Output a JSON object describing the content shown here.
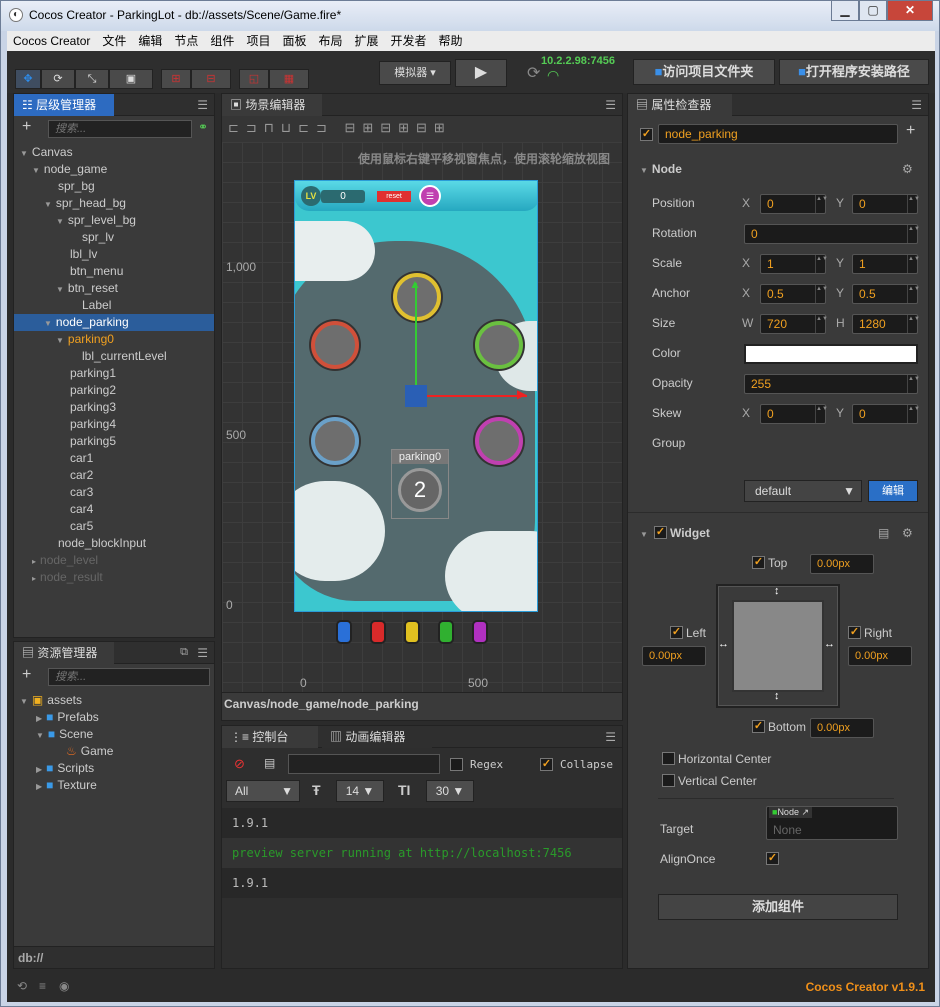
{
  "window": {
    "title": "Cocos Creator - ParkingLot - db://assets/Scene/Game.fire*",
    "min": "▁",
    "max": "▢",
    "close": "✕"
  },
  "menu": [
    "Cocos Creator",
    "文件",
    "编辑",
    "节点",
    "组件",
    "项目",
    "面板",
    "布局",
    "扩展",
    "开发者",
    "帮助"
  ],
  "toolbar": {
    "platform": "模拟器",
    "ip": "10.2.2.98:7456",
    "open_project": "访问项目文件夹",
    "open_install": "打开程序安装路径"
  },
  "hierarchy": {
    "title": "层级管理器",
    "search_placeholder": "搜索...",
    "items": [
      {
        "label": "Canvas",
        "depth": 0,
        "arrow": "▼"
      },
      {
        "label": "node_game",
        "depth": 1,
        "arrow": "▼"
      },
      {
        "label": "spr_bg",
        "depth": 2,
        "arrow": ""
      },
      {
        "label": "spr_head_bg",
        "depth": 2,
        "arrow": "▼"
      },
      {
        "label": "spr_level_bg",
        "depth": 3,
        "arrow": "▼"
      },
      {
        "label": "spr_lv",
        "depth": 4,
        "arrow": ""
      },
      {
        "label": "lbl_lv",
        "depth": 3,
        "arrow": ""
      },
      {
        "label": "btn_menu",
        "depth": 3,
        "arrow": ""
      },
      {
        "label": "btn_reset",
        "depth": 3,
        "arrow": "▼"
      },
      {
        "label": "Label",
        "depth": 4,
        "arrow": ""
      },
      {
        "label": "node_parking",
        "depth": 2,
        "arrow": "▼",
        "selected": true
      },
      {
        "label": "parking0",
        "depth": 3,
        "arrow": "▼",
        "highlight": true
      },
      {
        "label": "lbl_currentLevel",
        "depth": 4,
        "arrow": ""
      },
      {
        "label": "parking1",
        "depth": 3,
        "arrow": ""
      },
      {
        "label": "parking2",
        "depth": 3,
        "arrow": ""
      },
      {
        "label": "parking3",
        "depth": 3,
        "arrow": ""
      },
      {
        "label": "parking4",
        "depth": 3,
        "arrow": ""
      },
      {
        "label": "parking5",
        "depth": 3,
        "arrow": ""
      },
      {
        "label": "car1",
        "depth": 3,
        "arrow": ""
      },
      {
        "label": "car2",
        "depth": 3,
        "arrow": ""
      },
      {
        "label": "car3",
        "depth": 3,
        "arrow": ""
      },
      {
        "label": "car4",
        "depth": 3,
        "arrow": ""
      },
      {
        "label": "car5",
        "depth": 3,
        "arrow": ""
      },
      {
        "label": "node_blockInput",
        "depth": 2,
        "arrow": ""
      },
      {
        "label": "node_level",
        "depth": 1,
        "arrow": "▸",
        "dim": true
      },
      {
        "label": "node_result",
        "depth": 1,
        "arrow": "▸",
        "dim": true
      }
    ]
  },
  "assets": {
    "title": "资源管理器",
    "search_placeholder": "搜索...",
    "path": "db://",
    "items": [
      {
        "label": "assets",
        "depth": 0,
        "arrow": "▼",
        "icon": "assets-icon"
      },
      {
        "label": "Prefabs",
        "depth": 1,
        "arrow": "▶",
        "icon": "folder-icon"
      },
      {
        "label": "Scene",
        "depth": 1,
        "arrow": "▼",
        "icon": "folder-icon"
      },
      {
        "label": "Game",
        "depth": 2,
        "arrow": "",
        "icon": "fire-icon"
      },
      {
        "label": "Scripts",
        "depth": 1,
        "arrow": "▶",
        "icon": "folder-icon"
      },
      {
        "label": "Texture",
        "depth": 1,
        "arrow": "▶",
        "icon": "folder-icon"
      }
    ]
  },
  "scene": {
    "title": "场景编辑器",
    "hint": "使用鼠标右键平移视窗焦点，使用滚轮缩放视图",
    "y_ticks": [
      "1,000",
      "500",
      "0"
    ],
    "x_ticks": [
      "0",
      "500"
    ],
    "breadcrumb": "Canvas/node_game/node_parking",
    "game": {
      "lv": "LV",
      "level": "0",
      "reset": "reset",
      "selected_name": "parking0",
      "selected_number": "2"
    },
    "colors": {
      "ring_yellow": "#e0c030",
      "ring_red": "#d0503a",
      "ring_green": "#6ac040",
      "ring_blue": "#6aa0c8",
      "ring_purple": "#c040b0"
    }
  },
  "console": {
    "tab_console": "控制台",
    "tab_anim": "动画编辑器",
    "regex": "Regex",
    "collapse": "Collapse",
    "filter": "All",
    "font_size": "14",
    "line_height": "30",
    "lines": [
      {
        "text": "1.9.1",
        "color": "#bbbbbb"
      },
      {
        "text": "preview server running at http://localhost:7456",
        "color": "#2a9a2a"
      },
      {
        "text": "1.9.1",
        "color": "#bbbbbb"
      }
    ]
  },
  "inspector": {
    "title": "属性检查器",
    "node_name": "node_parking",
    "node_section": "Node",
    "position": {
      "label": "Position",
      "x": "0",
      "y": "0"
    },
    "rotation": {
      "label": "Rotation",
      "value": "0"
    },
    "scale": {
      "label": "Scale",
      "x": "1",
      "y": "1"
    },
    "anchor": {
      "label": "Anchor",
      "x": "0.5",
      "y": "0.5"
    },
    "size": {
      "label": "Size",
      "w": "720",
      "h": "1280"
    },
    "color": {
      "label": "Color",
      "value": "#ffffff"
    },
    "opacity": {
      "label": "Opacity",
      "value": "255"
    },
    "skew": {
      "label": "Skew",
      "x": "0",
      "y": "0"
    },
    "group": {
      "label": "Group",
      "value": "default",
      "edit": "编辑"
    },
    "widget": {
      "title": "Widget",
      "top": "Top",
      "left": "Left",
      "right": "Right",
      "bottom": "Bottom",
      "top_val": "0.00px",
      "left_val": "0.00px",
      "right_val": "0.00px",
      "bottom_val": "0.00px",
      "hcenter": "Horizontal Center",
      "vcenter": "Vertical Center",
      "target": "Target",
      "target_tag": "Node",
      "target_val": "None",
      "align_once": "AlignOnce"
    },
    "add_component": "添加组件"
  },
  "footer": {
    "version": "Cocos Creator v1.9.1"
  }
}
